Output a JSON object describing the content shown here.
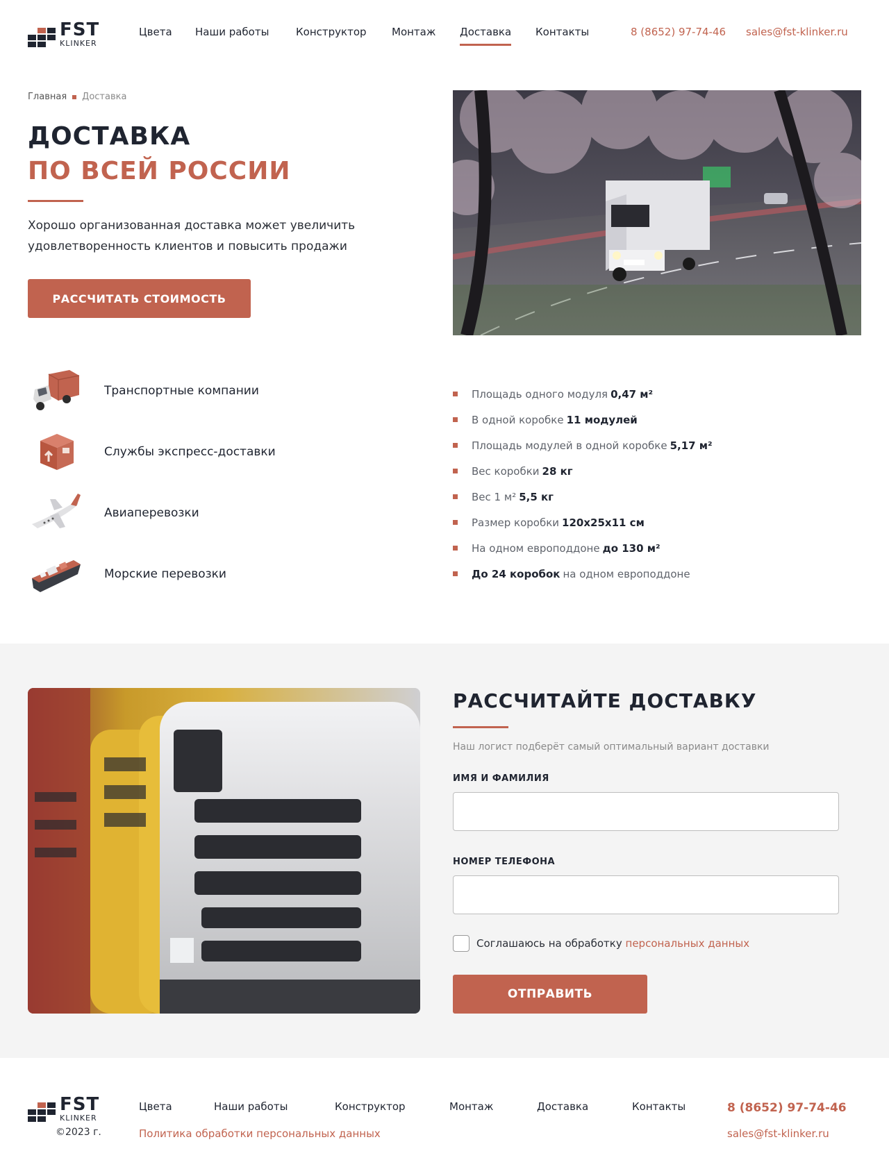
{
  "brand": {
    "name": "FST",
    "subname": "KLINKER"
  },
  "nav": [
    {
      "label": "Цвета"
    },
    {
      "label": "Наши работы"
    },
    {
      "label": "Конструктор"
    },
    {
      "label": "Монтаж"
    },
    {
      "label": "Доставка",
      "active": true
    },
    {
      "label": "Контакты"
    }
  ],
  "contacts": {
    "phone": "8 (8652) 97-74-46",
    "email": "sales@fst-klinker.ru"
  },
  "breadcrumb": {
    "home": "Главная",
    "current": "Доставка"
  },
  "hero": {
    "title_line1": "ДОСТАВКА",
    "title_line2": "ПО ВСЕЙ РОССИИ",
    "lead": "Хорошо организованная доставка может увеличить удовлетворенность клиентов и повысить продажи",
    "cta": "РАССЧИТАТЬ СТОИМОСТЬ"
  },
  "delivery_methods": [
    {
      "label": "Транспортные компании",
      "icon": "truck-icon"
    },
    {
      "label": "Службы экспресс-доставки",
      "icon": "parcel-box-icon"
    },
    {
      "label": "Авиаперевозки",
      "icon": "airplane-icon"
    },
    {
      "label": "Морские перевозки",
      "icon": "cargo-ship-icon"
    }
  ],
  "specs": [
    {
      "text": "Площадь одного модуля",
      "value": "0,47 м²"
    },
    {
      "text": "В одной коробке",
      "value": "11 модулей"
    },
    {
      "text": "Площадь модулей в одной коробке",
      "value": "5,17 м²"
    },
    {
      "text": "Вес коробки",
      "value": "28 кг"
    },
    {
      "text": "Вес 1 м²",
      "value": "5,5 кг"
    },
    {
      "text": "Размер коробки",
      "value": "120x25x11 см"
    },
    {
      "text": "На одном европоддоне",
      "value": "до 130 м²"
    },
    {
      "value_first": "До 24 коробок",
      "text": "на одном европоддоне"
    }
  ],
  "calc": {
    "title": "РАССЧИТАЙТЕ ДОСТАВКУ",
    "subtitle": "Наш логист подберёт самый оптимальный вариант доставки",
    "name_label": "ИМЯ И ФАМИЛИЯ",
    "name_value": "",
    "phone_label": "НОМЕР ТЕЛЕФОНА",
    "phone_value": "",
    "agree_text": "Соглашаюсь на обработку",
    "agree_link": "персональных данных",
    "submit": "ОТПРАВИТЬ"
  },
  "footer": {
    "copyright": "©2023 г.",
    "policy": "Политика обработки персональных данных"
  },
  "colors": {
    "accent": "#c1634f",
    "dark": "#1f2430",
    "section_bg": "#f4f4f4"
  }
}
